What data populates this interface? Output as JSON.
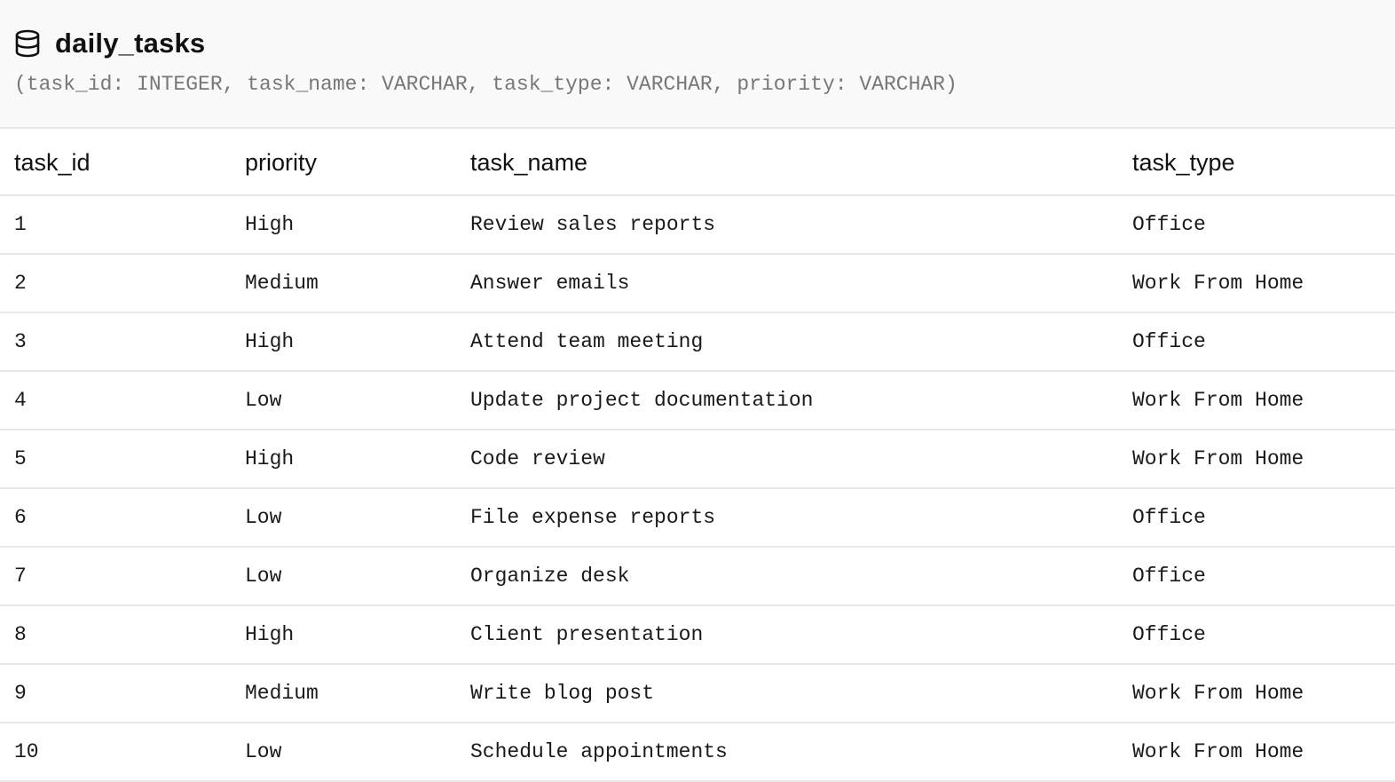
{
  "table": {
    "name": "daily_tasks",
    "schema": "(task_id: INTEGER, task_name: VARCHAR, task_type: VARCHAR, priority: VARCHAR)",
    "icon": "database-icon"
  },
  "columns": [
    "task_id",
    "priority",
    "task_name",
    "task_type"
  ],
  "rows": [
    {
      "task_id": "1",
      "priority": "High",
      "task_name": "Review sales reports",
      "task_type": "Office"
    },
    {
      "task_id": "2",
      "priority": "Medium",
      "task_name": "Answer emails",
      "task_type": "Work From Home"
    },
    {
      "task_id": "3",
      "priority": "High",
      "task_name": "Attend team meeting",
      "task_type": "Office"
    },
    {
      "task_id": "4",
      "priority": "Low",
      "task_name": "Update project documentation",
      "task_type": "Work From Home"
    },
    {
      "task_id": "5",
      "priority": "High",
      "task_name": "Code review",
      "task_type": "Work From Home"
    },
    {
      "task_id": "6",
      "priority": "Low",
      "task_name": "File expense reports",
      "task_type": "Office"
    },
    {
      "task_id": "7",
      "priority": "Low",
      "task_name": "Organize desk",
      "task_type": "Office"
    },
    {
      "task_id": "8",
      "priority": "High",
      "task_name": "Client presentation",
      "task_type": "Office"
    },
    {
      "task_id": "9",
      "priority": "Medium",
      "task_name": "Write blog post",
      "task_type": "Work From Home"
    },
    {
      "task_id": "10",
      "priority": "Low",
      "task_name": "Schedule appointments",
      "task_type": "Work From Home"
    }
  ]
}
